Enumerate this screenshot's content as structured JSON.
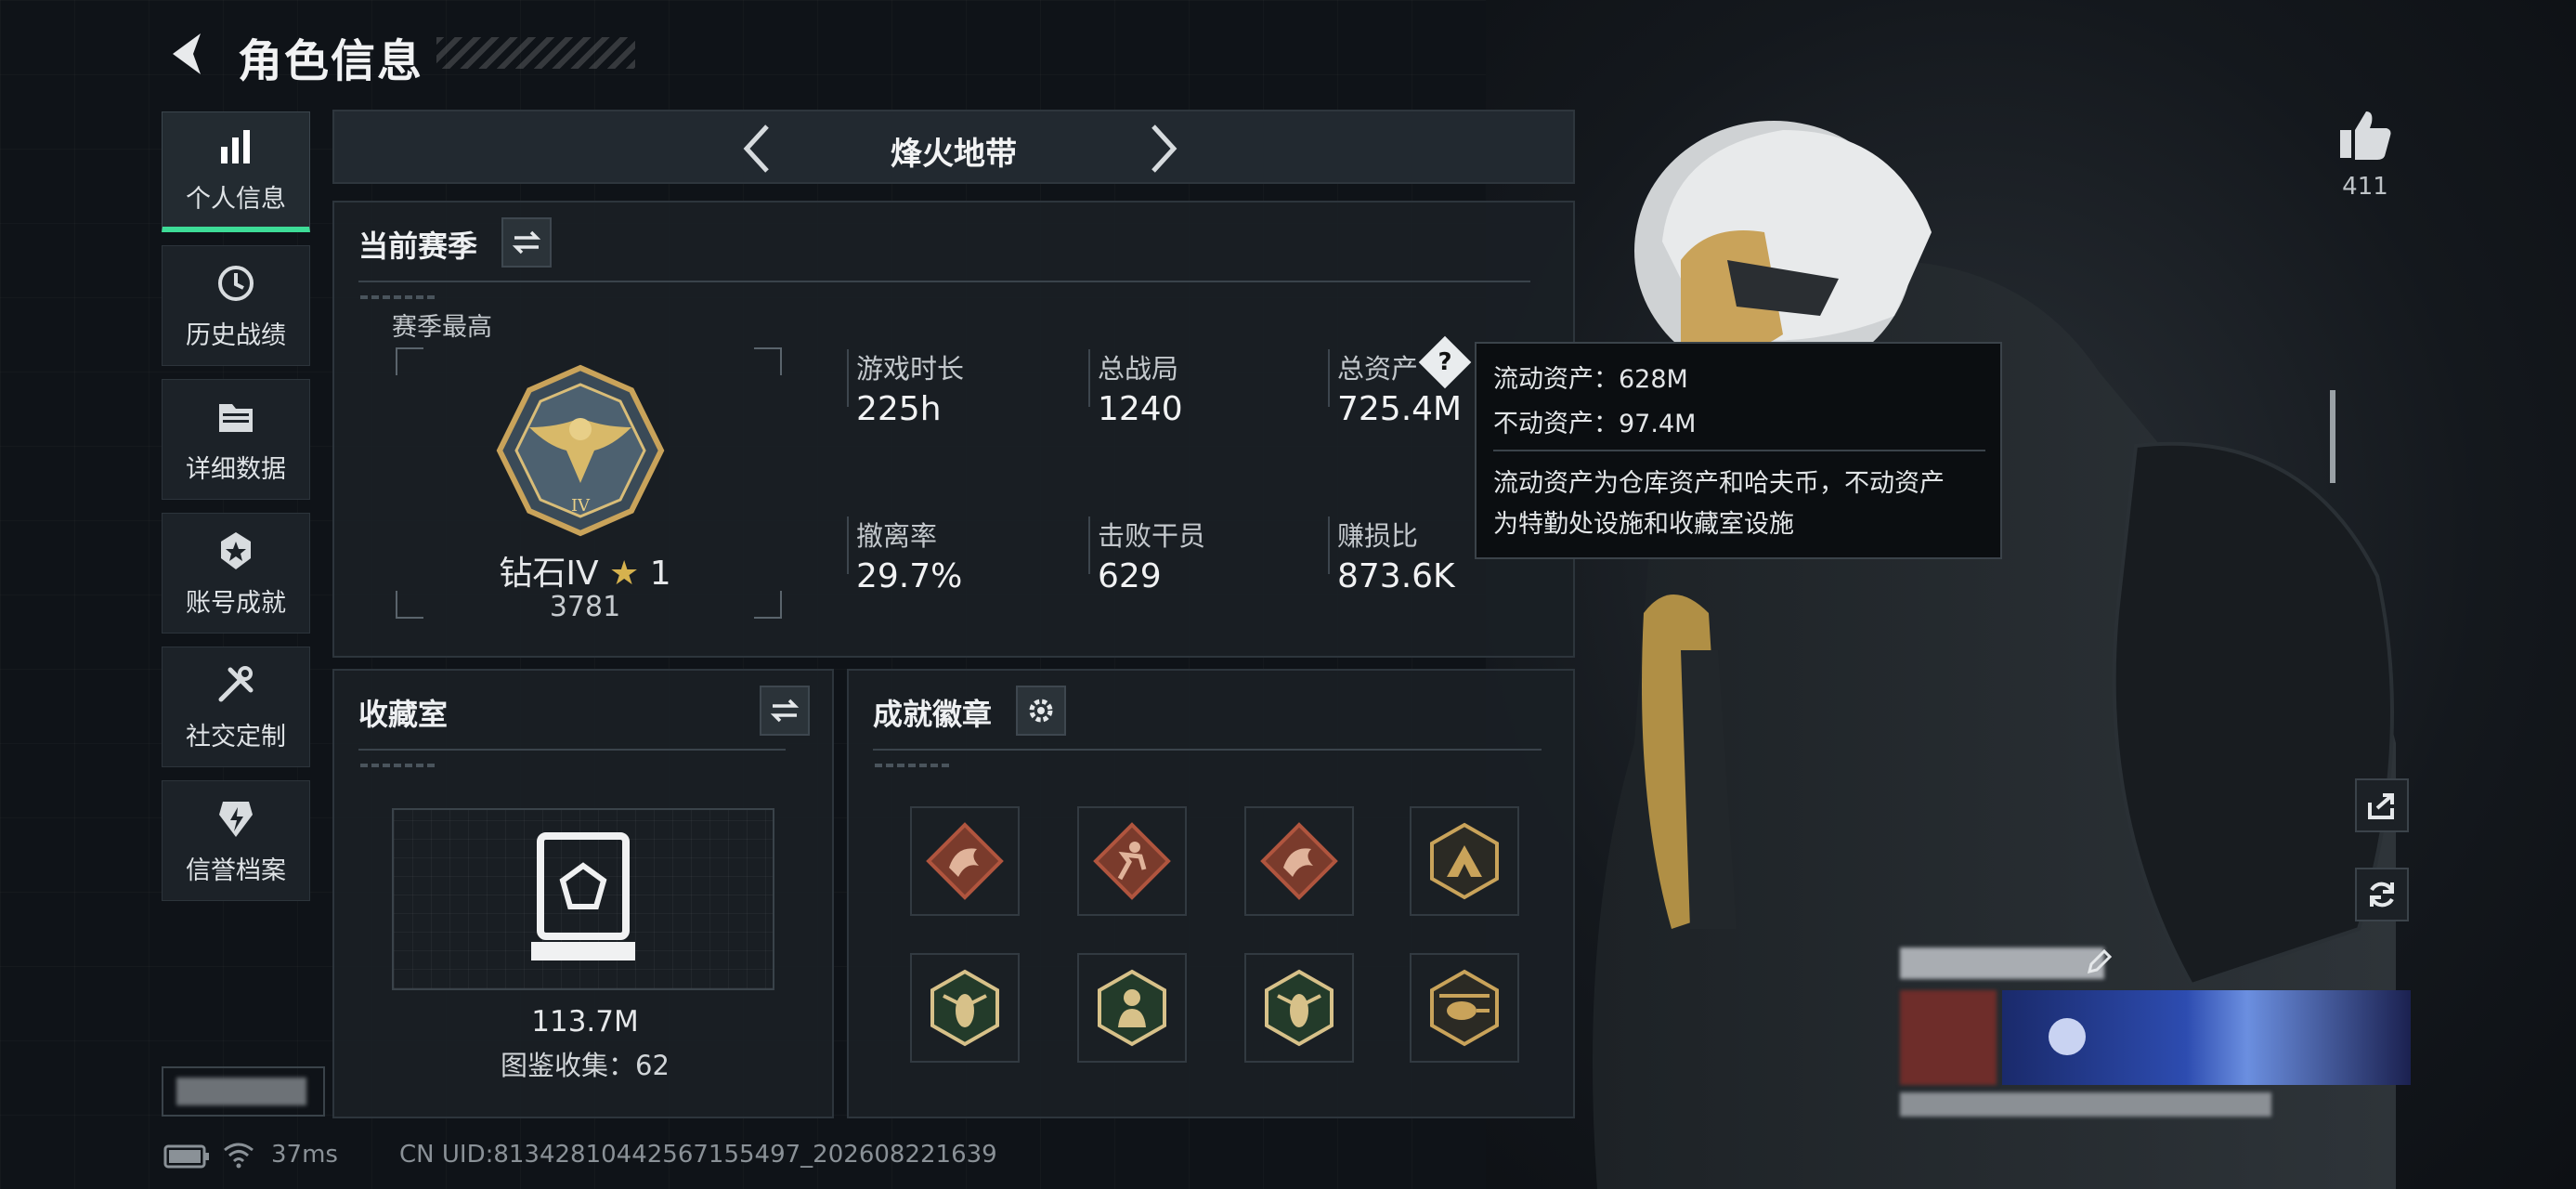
{
  "header": {
    "title": "角色信息"
  },
  "sidebar": {
    "items": [
      {
        "label": "个人信息",
        "icon": "bar-chart-icon",
        "active": true
      },
      {
        "label": "历史战绩",
        "icon": "history-icon"
      },
      {
        "label": "详细数据",
        "icon": "folder-icon"
      },
      {
        "label": "账号成就",
        "icon": "achievement-icon"
      },
      {
        "label": "社交定制",
        "icon": "tools-icon"
      },
      {
        "label": "信誉档案",
        "icon": "credit-icon"
      }
    ]
  },
  "mode": {
    "label": "烽火地带"
  },
  "season": {
    "title": "当前赛季",
    "best_label": "赛季最高",
    "rank_name": "钻石IV",
    "rank_stars": "1",
    "rank_score": "3781",
    "stats": [
      {
        "label": "游戏时长",
        "value": "225h"
      },
      {
        "label": "总战局",
        "value": "1240"
      },
      {
        "label": "总资产",
        "value": "725.4M",
        "has_help": true
      },
      {
        "label": "撤离率",
        "value": "29.7%"
      },
      {
        "label": "击败干员",
        "value": "629"
      },
      {
        "label": "赚损比",
        "value": "873.6K"
      }
    ]
  },
  "tooltip": {
    "line1": "流动资产：628M",
    "line2": "不动资产：97.4M",
    "desc1": "流动资产为仓库资产和哈夫币，不动资产",
    "desc2": "为特勤处设施和收藏室设施"
  },
  "collection": {
    "title": "收藏室",
    "value": "113.7M",
    "count_text": "图鉴收集：62"
  },
  "achievements": {
    "title": "成就徽章",
    "badges": [
      {
        "icon": "dragon-badge-icon",
        "color": "#b0553e"
      },
      {
        "icon": "runner-badge-icon",
        "color": "#b0553e"
      },
      {
        "icon": "dragon-badge-icon",
        "color": "#b0553e"
      },
      {
        "icon": "mountain-badge-icon",
        "color": "#c9a35a"
      },
      {
        "icon": "wasp-badge-icon",
        "color": "#3f8a4f"
      },
      {
        "icon": "soldier-badge-icon",
        "color": "#3f8a4f"
      },
      {
        "icon": "wasp-badge-icon",
        "color": "#3f8a4f"
      },
      {
        "icon": "helicopter-badge-icon",
        "color": "#c9a35a"
      }
    ]
  },
  "likes": {
    "count": "411"
  },
  "status": {
    "ping": "37ms",
    "uid": "CN UID:8134281044256715​5497_202608221639"
  },
  "colors": {
    "accent": "#3ddc97",
    "gold": "#c9a35a",
    "panel": "#1a1f25"
  }
}
